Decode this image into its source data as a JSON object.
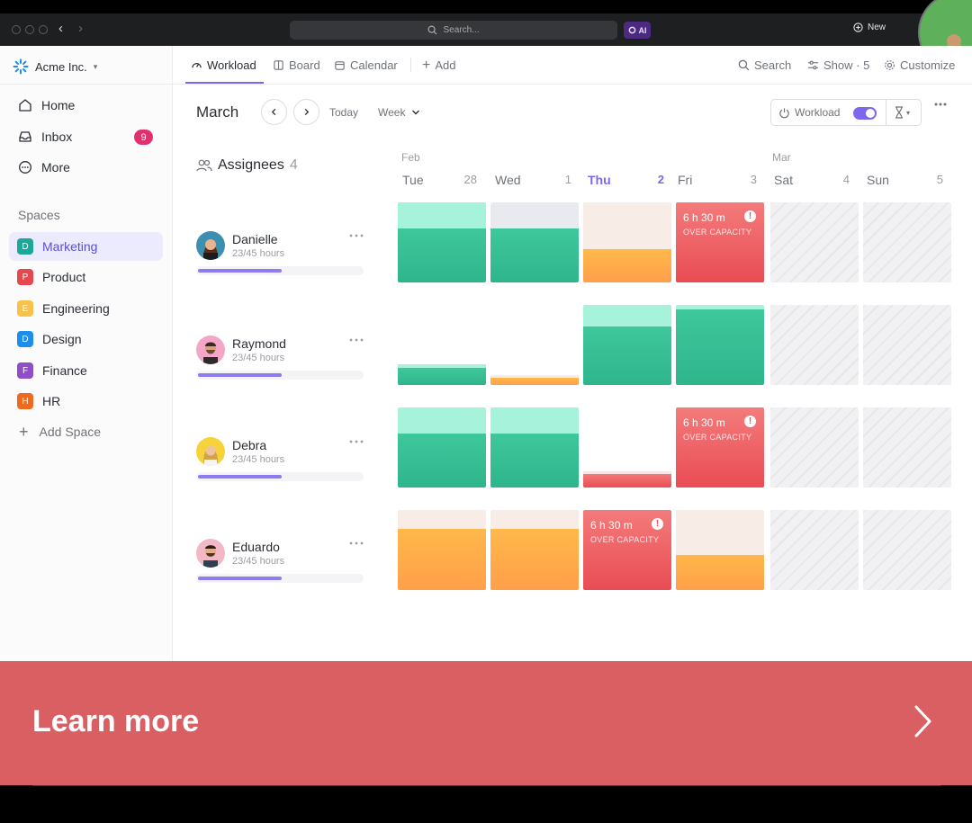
{
  "titlebar": {
    "search_placeholder": "Search...",
    "ai_label": "AI",
    "new_label": "New"
  },
  "sidebar": {
    "workspace": "Acme Inc.",
    "nav": [
      {
        "label": "Home",
        "icon": "home-icon"
      },
      {
        "label": "Inbox",
        "icon": "inbox-icon",
        "badge": "9"
      },
      {
        "label": "More",
        "icon": "more-icon"
      }
    ],
    "spaces_label": "Spaces",
    "spaces": [
      {
        "letter": "D",
        "label": "Marketing",
        "color": "#1aa89a",
        "active": true
      },
      {
        "letter": "P",
        "label": "Product",
        "color": "#e5484d"
      },
      {
        "letter": "E",
        "label": "Engineering",
        "color": "#f7c14a"
      },
      {
        "letter": "D",
        "label": "Design",
        "color": "#1c8ef0"
      },
      {
        "letter": "F",
        "label": "Finance",
        "color": "#8e4fc6"
      },
      {
        "letter": "H",
        "label": "HR",
        "color": "#ef6a1e"
      }
    ],
    "add_space": "Add Space"
  },
  "views": {
    "tabs": [
      {
        "label": "Workload",
        "active": true
      },
      {
        "label": "Board"
      },
      {
        "label": "Calendar"
      },
      {
        "label": "Add"
      }
    ],
    "right": {
      "search": "Search",
      "show": "Show · 5",
      "customize": "Customize"
    }
  },
  "toolbar": {
    "month": "March",
    "today": "Today",
    "range": "Week",
    "workload_toggle": "Workload",
    "toggle_on": true
  },
  "assignees": {
    "label": "Assignees",
    "count": "4"
  },
  "days": [
    {
      "month": "Feb",
      "name": "Tue",
      "num": "28"
    },
    {
      "name": "Wed",
      "num": "1"
    },
    {
      "name": "Thu",
      "num": "2",
      "today": true
    },
    {
      "name": "Fri",
      "num": "3"
    },
    {
      "month": "Mar",
      "name": "Sat",
      "num": "4"
    },
    {
      "name": "Sun",
      "num": "5"
    }
  ],
  "people": [
    {
      "name": "Danielle",
      "hours": "23/45 hours",
      "progress": 0.51
    },
    {
      "name": "Raymond",
      "hours": "23/45 hours",
      "progress": 0.51
    },
    {
      "name": "Debra",
      "hours": "23/45 hours",
      "progress": 0.51
    },
    {
      "name": "Eduardo",
      "hours": "23/45 hours",
      "progress": 0.51
    }
  ],
  "over_capacity": {
    "time": "6 h 30 m",
    "label": "OVER CAPACITY"
  },
  "banner": {
    "text": "Learn more"
  },
  "colors": {
    "accent": "#7b68ee",
    "capacity_ok": "#2fb58b",
    "capacity_free": "#a7f2da",
    "capacity_warn": "#ffa94d",
    "over_capacity": "#e94c54",
    "banner": "#d95f63"
  }
}
